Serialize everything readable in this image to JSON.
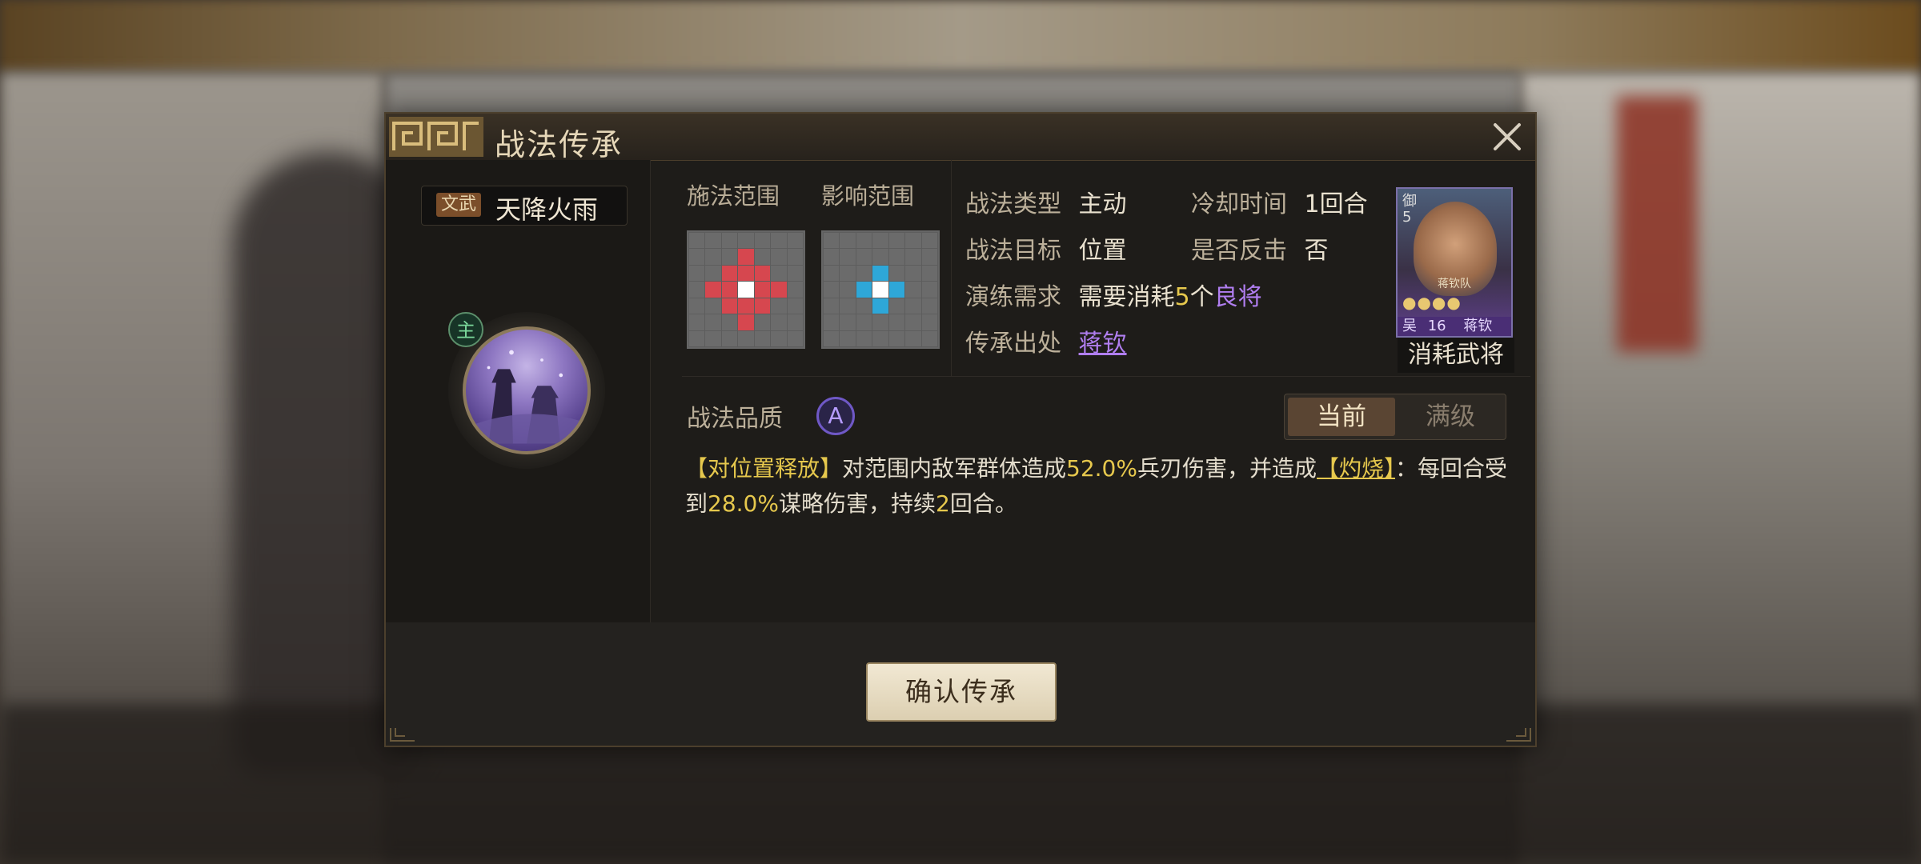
{
  "dialog": {
    "title": "战法传承",
    "close_icon": "close-icon"
  },
  "skill": {
    "school_tag": "文武",
    "name": "天降火雨",
    "main_badge": "主",
    "icon": "burning-siege-tower-icon"
  },
  "range": {
    "cast_label": "施法范围",
    "effect_label": "影响范围",
    "cast_color": "#d6474f",
    "effect_color": "#2ea7d8"
  },
  "info": {
    "type_label": "战法类型",
    "type_value": "主动",
    "cooldown_label": "冷却时间",
    "cooldown_value": "1回合",
    "target_label": "战法目标",
    "target_value": "位置",
    "counter_label": "是否反击",
    "counter_value": "否",
    "train_label": "演练需求",
    "train_prefix": "需要消耗",
    "train_count": "5",
    "train_unit": "个",
    "train_quality": "良将",
    "source_label": "传承出处",
    "source_value": "蒋钦"
  },
  "general": {
    "role_tag": "御",
    "cost": "5",
    "troop_name": "蒋钦队",
    "stars": "●●●●",
    "faction": "吴",
    "level": "16",
    "name": "蒋钦",
    "caption": "消耗武将"
  },
  "quality": {
    "label": "战法品质",
    "grade": "A"
  },
  "toggle": {
    "current": "当前",
    "max": "满级"
  },
  "description": {
    "tag": "【对位置释放】",
    "part1": "对范围内敌军群体造成",
    "damage": "52.0%",
    "part2": "兵刃伤害，并造成",
    "status": "【灼烧】",
    "part3": "：每回合受到",
    "burn": "28.0%",
    "part4": "谋略伤害，持续",
    "turns": "2",
    "part5": "回合。"
  },
  "footer": {
    "confirm": "确认传承"
  }
}
